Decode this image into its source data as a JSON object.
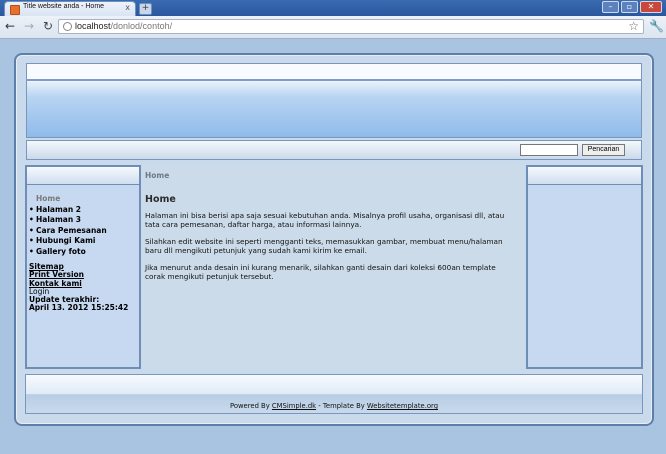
{
  "browser": {
    "tab_title": "Title website anda - Home",
    "tab_close": "x",
    "new_tab": "+",
    "url_host": "localhost",
    "url_path": "/donlod/contoh/",
    "window_buttons": {
      "minimize": "–",
      "maximize": "▫",
      "close": "✕"
    },
    "nav": {
      "back": "←",
      "forward": "→",
      "reload": "↻"
    }
  },
  "search": {
    "input_value": "",
    "button_label": "Pencarian"
  },
  "menu": {
    "items": [
      {
        "label": "Home",
        "active": true
      },
      {
        "label": "Halaman 2",
        "active": false
      },
      {
        "label": "Halaman 3",
        "active": false
      },
      {
        "label": "Cara Pemesanan",
        "active": false
      },
      {
        "label": "Hubungi Kami",
        "active": false
      },
      {
        "label": "Gallery foto",
        "active": false
      }
    ]
  },
  "side_links": {
    "sitemap": "Sitemap",
    "print": "Print Version",
    "contact": "Kontak kami",
    "login": "Login",
    "update_label": "Update terakhir:",
    "update_value": "April 13. 2012 15:25:42"
  },
  "main": {
    "breadcrumb": "Home",
    "title": "Home",
    "paragraphs": [
      "Halaman ini bisa berisi apa saja sesuai kebutuhan anda. Misalnya profil usaha, organisasi dll, atau tata cara pemesanan, daftar harga, atau informasi lainnya.",
      "Silahkan edit website ini seperti mengganti teks, memasukkan gambar, membuat menu/halaman baru dll mengikuti petunjuk yang sudah kami kirim ke email.",
      "Jika menurut anda desain ini kurang menarik, silahkan ganti desain dari koleksi 600an template corak mengikuti petunjuk tersebut."
    ]
  },
  "footer": {
    "prefix": "Powered By ",
    "cms_link": "CMSimple.dk",
    "middle": " - Template By ",
    "template_link": "Websitetemplate.org"
  },
  "colors": {
    "page_background": "#a9c4e0",
    "panel": "#c6d9f0",
    "border": "#6f8db7",
    "header_gradient_end": "#8fbbea"
  }
}
